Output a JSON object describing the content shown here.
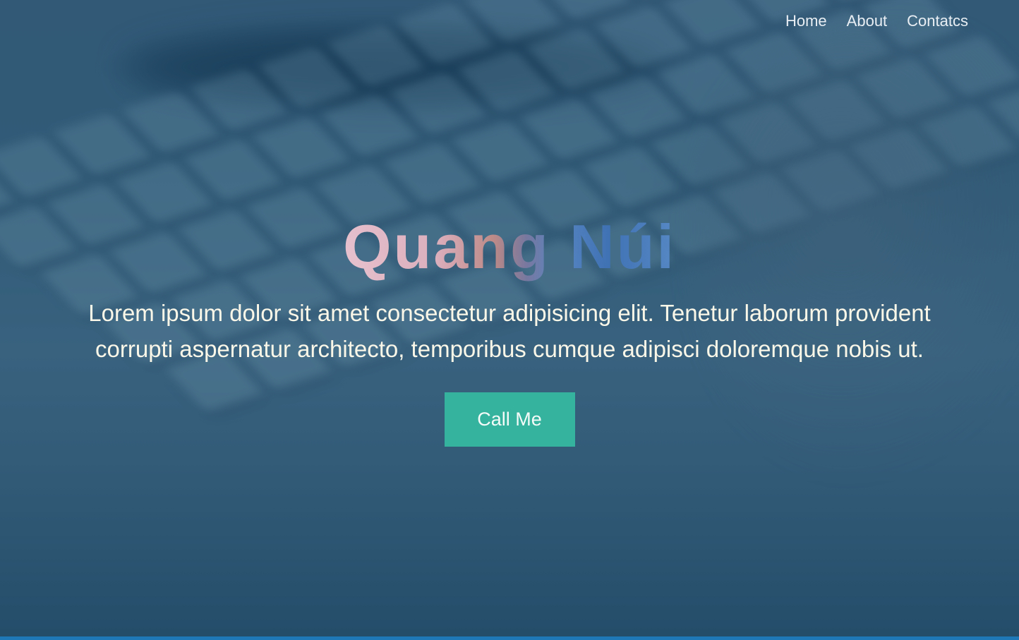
{
  "nav": {
    "items": [
      {
        "label": "Home"
      },
      {
        "label": "About"
      },
      {
        "label": "Contatcs"
      }
    ]
  },
  "hero": {
    "title": "Quang Núi",
    "description": "Lorem ipsum dolor sit amet consectetur adipisicing elit. Tenetur laborum provident corrupti aspernatur architecto, temporibus cumque adipisci doloremque nobis ut.",
    "cta_label": "Call Me"
  },
  "colors": {
    "cta_background": "#36b39e",
    "text": "#fbf7e8",
    "bottom_bar": "#1e78b8"
  }
}
